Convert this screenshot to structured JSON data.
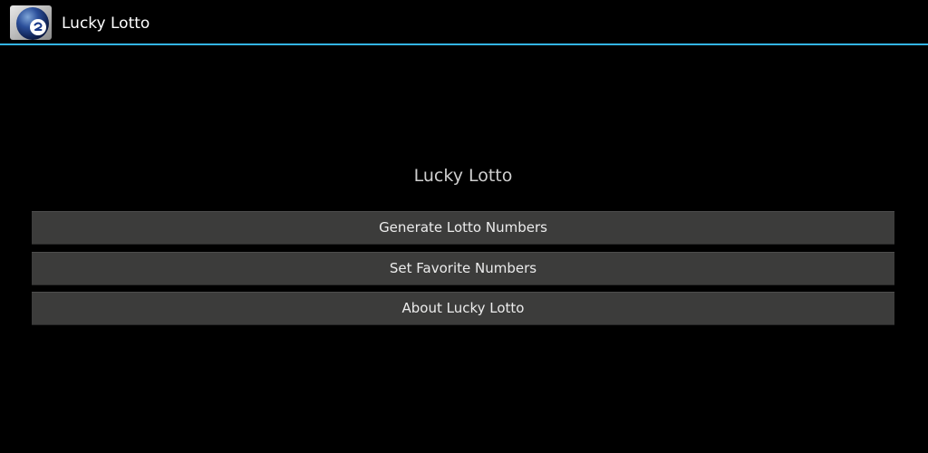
{
  "action_bar": {
    "app_icon": "lotto-ball-icon",
    "title": "Lucky Lotto",
    "accent_color": "#33b5e5"
  },
  "main": {
    "heading": "Lucky Lotto",
    "buttons": [
      {
        "label": "Generate Lotto Numbers"
      },
      {
        "label": "Set Favorite Numbers"
      },
      {
        "label": "About Lucky Lotto"
      }
    ]
  }
}
